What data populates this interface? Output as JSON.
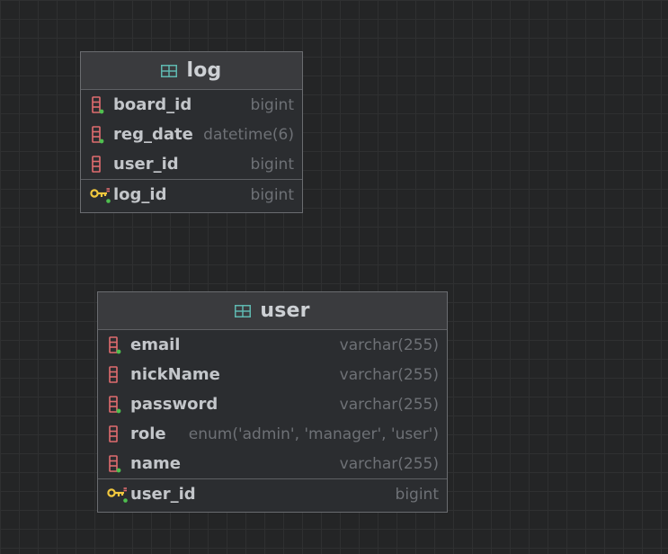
{
  "tables": [
    {
      "name": "log",
      "columns": [
        {
          "name": "board_id",
          "type": "bigint",
          "icon": "column-not-null-icon"
        },
        {
          "name": "reg_date",
          "type": "datetime(6)",
          "icon": "column-not-null-icon"
        },
        {
          "name": "user_id",
          "type": "bigint",
          "icon": "column-icon"
        }
      ],
      "keys": [
        {
          "name": "log_id",
          "type": "bigint",
          "icon": "primary-key-icon"
        }
      ]
    },
    {
      "name": "user",
      "columns": [
        {
          "name": "email",
          "type": "varchar(255)",
          "icon": "column-not-null-icon"
        },
        {
          "name": "nickName",
          "type": "varchar(255)",
          "icon": "column-icon"
        },
        {
          "name": "password",
          "type": "varchar(255)",
          "icon": "column-not-null-icon"
        },
        {
          "name": "role",
          "type": "enum('admin', 'manager', 'user')",
          "icon": "column-icon"
        },
        {
          "name": "name",
          "type": "varchar(255)",
          "icon": "column-not-null-icon"
        }
      ],
      "keys": [
        {
          "name": "user_id",
          "type": "bigint",
          "icon": "primary-key-icon"
        }
      ]
    }
  ],
  "colors": {
    "background": "#242526",
    "grid": "#2f3031",
    "table_icon": "#5fb8b0",
    "column_icon": "#e06c6f",
    "not_null_dot": "#4fbf4f",
    "key_icon": "#f2c83e"
  }
}
